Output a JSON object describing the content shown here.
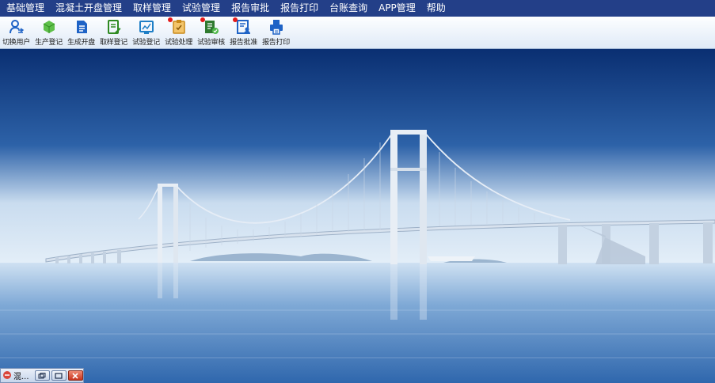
{
  "menu": [
    {
      "label": "基础管理"
    },
    {
      "label": "混凝土开盘管理"
    },
    {
      "label": "取样管理"
    },
    {
      "label": "试验管理"
    },
    {
      "label": "报告审批"
    },
    {
      "label": "报告打印"
    },
    {
      "label": "台账查询"
    },
    {
      "label": "APP管理"
    },
    {
      "label": "帮助"
    }
  ],
  "toolbar": [
    {
      "label": "切换用户",
      "icon": "switch-user-icon",
      "badge": false
    },
    {
      "label": "生产登记",
      "icon": "production-register-icon",
      "badge": false
    },
    {
      "label": "生成开盘",
      "icon": "generate-batch-icon",
      "badge": false
    },
    {
      "label": "取样登记",
      "icon": "sampling-register-icon",
      "badge": false
    },
    {
      "label": "试验登记",
      "icon": "test-register-icon",
      "badge": false
    },
    {
      "label": "试验处理",
      "icon": "test-process-icon",
      "badge": true
    },
    {
      "label": "试验审核",
      "icon": "test-review-icon",
      "badge": true
    },
    {
      "label": "报告批准",
      "icon": "report-approve-icon",
      "badge": true
    },
    {
      "label": "报告打印",
      "icon": "report-print-icon",
      "badge": false
    }
  ],
  "taskbar": {
    "title": "混..."
  },
  "colors": {
    "menubar": "#233f88",
    "accent": "#1f63c6",
    "badge": "#e31b1b",
    "sky": "#0d3d86",
    "water": "#5f92c8"
  }
}
